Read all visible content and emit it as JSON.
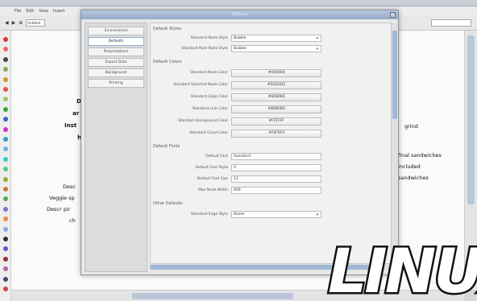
{
  "menubar": {
    "items": [
      "File",
      "Edit",
      "View",
      "Insert"
    ]
  },
  "toolbar": {
    "address": "Untitled"
  },
  "palette": {
    "colors": [
      "#d33",
      "#e66",
      "#444",
      "#8a6",
      "#c93",
      "#d55",
      "#9c6",
      "#3a3",
      "#36c",
      "#c3c",
      "#39c",
      "#6bd",
      "#3cc",
      "#5c8",
      "#9a3",
      "#c73",
      "#5a5",
      "#77c",
      "#e84",
      "#8ad",
      "#333",
      "#55c",
      "#933",
      "#a6a",
      "#447",
      "#c44"
    ]
  },
  "canvas": {
    "lines": [
      {
        "text": "D"
      },
      {
        "text": "ar"
      },
      {
        "text": "Inst"
      },
      {
        "text": "h"
      },
      {
        "text": "Desc"
      },
      {
        "text": "Veggie sp"
      },
      {
        "text": "Descr pir"
      },
      {
        "text": "ch"
      }
    ],
    "right_lines": [
      {
        "text": "grind"
      },
      {
        "text": "final sandwiches"
      },
      {
        "text": "Included"
      },
      {
        "text": "sandwiches"
      }
    ]
  },
  "dialog": {
    "title": "Options",
    "nav": [
      {
        "label": "Environment",
        "selected": false
      },
      {
        "label": "Defaults",
        "selected": true
      },
      {
        "label": "Presentations",
        "selected": false
      },
      {
        "label": "Export Data",
        "selected": false
      },
      {
        "label": "Background",
        "selected": false
      },
      {
        "label": "Printing",
        "selected": false
      }
    ],
    "sections": {
      "default_styles": "Default Styles",
      "default_colors": "Default Colors",
      "default_fonts": "Default Fonts",
      "other_defaults": "Other Defaults"
    },
    "styles": [
      {
        "label": "Standard Node Style",
        "value": "Bubble"
      },
      {
        "label": "Standard Root Node Style",
        "value": "Bubble"
      }
    ],
    "colors": [
      {
        "label": "Standard Node Color",
        "value": "#000000"
      },
      {
        "label": "Standard Selected Node Color",
        "value": "#D2D2D2"
      },
      {
        "label": "Standard Edge Color",
        "value": "#808080"
      },
      {
        "label": "Standard Link Color",
        "value": "#B0B0B0"
      },
      {
        "label": "Standard Background Color",
        "value": "#FFFFFF"
      },
      {
        "label": "Standard Cloud Color",
        "value": "#F0F0F0"
      }
    ],
    "fonts": [
      {
        "label": "Default Font",
        "value": "SansSerif"
      },
      {
        "label": "Default Font Style",
        "value": "0"
      },
      {
        "label": "Default Font Size",
        "value": "12"
      },
      {
        "label": "Max Node Width",
        "value": "600"
      }
    ],
    "other": [
      {
        "label": "Standard Edge Style",
        "value": "Bezier"
      }
    ]
  },
  "logo": {
    "text": "LINUX"
  }
}
